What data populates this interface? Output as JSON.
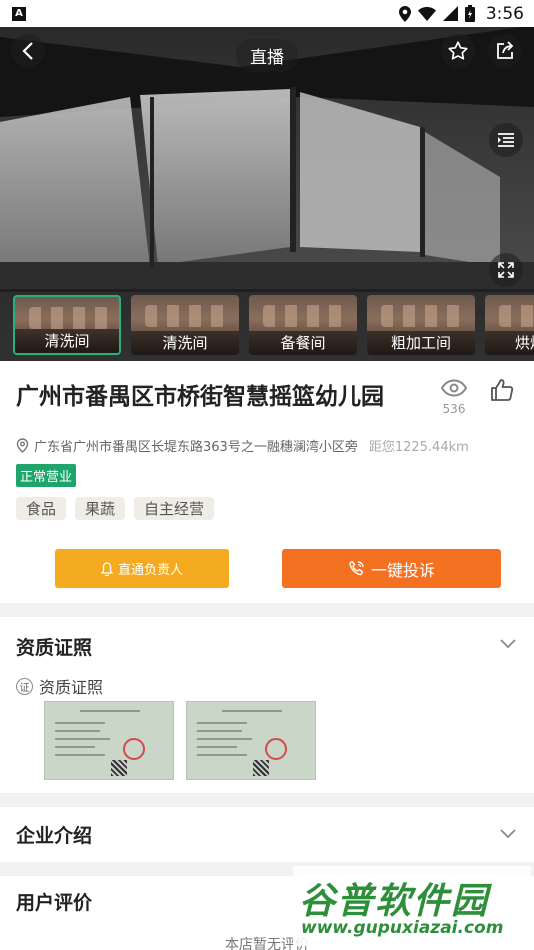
{
  "status_bar": {
    "time": "3:56"
  },
  "hero": {
    "live_label": "直播",
    "thumbnails": [
      {
        "label": "清洗间",
        "active": true
      },
      {
        "label": "清洗间",
        "active": false
      },
      {
        "label": "备餐间",
        "active": false
      },
      {
        "label": "粗加工间",
        "active": false
      },
      {
        "label": "烘焙间",
        "active": false
      }
    ]
  },
  "store": {
    "name": "广州市番禺区市桥街智慧摇篮幼儿园",
    "views": "536",
    "address": "广东省广州市番禺区长堤东路363号之一融穗澜湾小区旁",
    "distance": "距您1225.44km",
    "status": "正常营业",
    "tags": [
      "食品",
      "果蔬",
      "自主经营"
    ],
    "contact_button": "直通负责人",
    "complain_button": "一键投诉"
  },
  "license": {
    "section_title": "资质证照",
    "sub_label": "资质证照",
    "badge_char": "证",
    "cert_title": "食品经营许可证"
  },
  "company": {
    "section_title": "企业介绍"
  },
  "reviews": {
    "section_title": "用户评价",
    "empty_text": "本店暂无评价"
  },
  "watermark": {
    "brand": "谷普软件园",
    "url": "www.gupuxiazai.com"
  },
  "colors": {
    "green": "#1fa56c",
    "yellow": "#f5ab1f",
    "orange": "#f37121"
  }
}
